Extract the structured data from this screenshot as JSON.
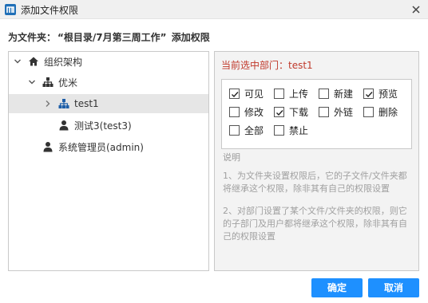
{
  "window": {
    "title": "添加文件权限",
    "logo_icon": "app-logo-icon",
    "close_icon": "close-icon"
  },
  "subtitle": {
    "prefix": "为文件夹：",
    "folder": "“根目录/7月第三周工作”",
    "suffix": "添加权限"
  },
  "tree": {
    "items": [
      {
        "label": "组织架构",
        "icon": "home-icon",
        "expanded": true,
        "level": 0
      },
      {
        "label": "优米",
        "icon": "org-icon",
        "expanded": true,
        "level": 1
      },
      {
        "label": "test1",
        "icon": "org-icon",
        "expanded": false,
        "selected": true,
        "level": 2
      },
      {
        "label": "测试3(test3)",
        "icon": "user-icon",
        "level": 2
      },
      {
        "label": "系统管理员(admin)",
        "icon": "user-icon",
        "level": 1
      }
    ]
  },
  "right": {
    "current_dept_label": "当前选中部门：test1",
    "permissions": [
      {
        "label": "可见",
        "checked": true
      },
      {
        "label": "上传",
        "checked": false
      },
      {
        "label": "新建",
        "checked": false
      },
      {
        "label": "预览",
        "checked": true
      },
      {
        "label": "修改",
        "checked": false
      },
      {
        "label": "下载",
        "checked": true
      },
      {
        "label": "外链",
        "checked": false
      },
      {
        "label": "删除",
        "checked": false
      },
      {
        "label": "全部",
        "checked": false
      },
      {
        "label": "禁止",
        "checked": false
      }
    ],
    "explain_title": "说明",
    "explain_1": "1、为文件夹设置权限后，它的子文件/文件夹都将继承这个权限，除非其有自己的权限设置",
    "explain_2": "2、对部门设置了某个文件/文件夹的权限，则它的子部门及用户都将继承这个权限，除非其有自己的权限设置"
  },
  "buttons": {
    "ok": "确定",
    "cancel": "取消"
  },
  "colors": {
    "accent": "#1e90ff",
    "current_dept": "#c0392b",
    "selected_row": "#e6e6e6"
  }
}
